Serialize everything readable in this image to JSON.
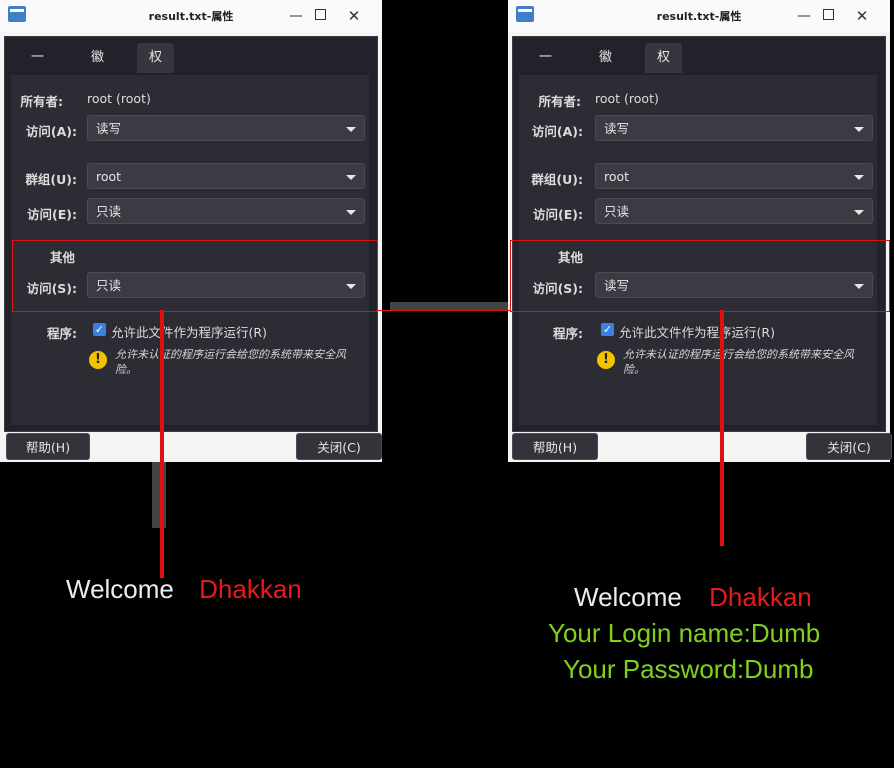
{
  "window": {
    "title": "result.txt-属性",
    "tabs": [
      "一般",
      "徽标",
      "权限"
    ],
    "owner_label": "所有者:",
    "owner_value": "root (root)",
    "access_a_label": "访问(A):",
    "access_a_value": "读写",
    "group_label": "群组(U):",
    "group_value": "root",
    "access_e_label": "访问(E):",
    "access_e_value": "只读",
    "other_label": "其他",
    "access_s_label": "访问(S):",
    "program_label": "程序:",
    "exec_checkbox_label": "允许此文件作为程序运行(R)",
    "warning_text": "允许未认证的程序运行会给您的系统带来安全风险。",
    "help_button": "帮助(H)",
    "close_button": "关闭(C)"
  },
  "left_window": {
    "access_s_value": "只读"
  },
  "right_window": {
    "access_s_value": "读写"
  },
  "left_caption": {
    "welcome": "Welcome",
    "name": "Dhakkan"
  },
  "right_caption": {
    "welcome": "Welcome",
    "name": "Dhakkan",
    "login": "Your Login name:Dumb",
    "password": "Your Password:Dumb"
  },
  "colors": {
    "highlight": "#e01010",
    "green_text": "#80d11e",
    "check": "#3b7fe0",
    "warning": "#f2c200"
  }
}
